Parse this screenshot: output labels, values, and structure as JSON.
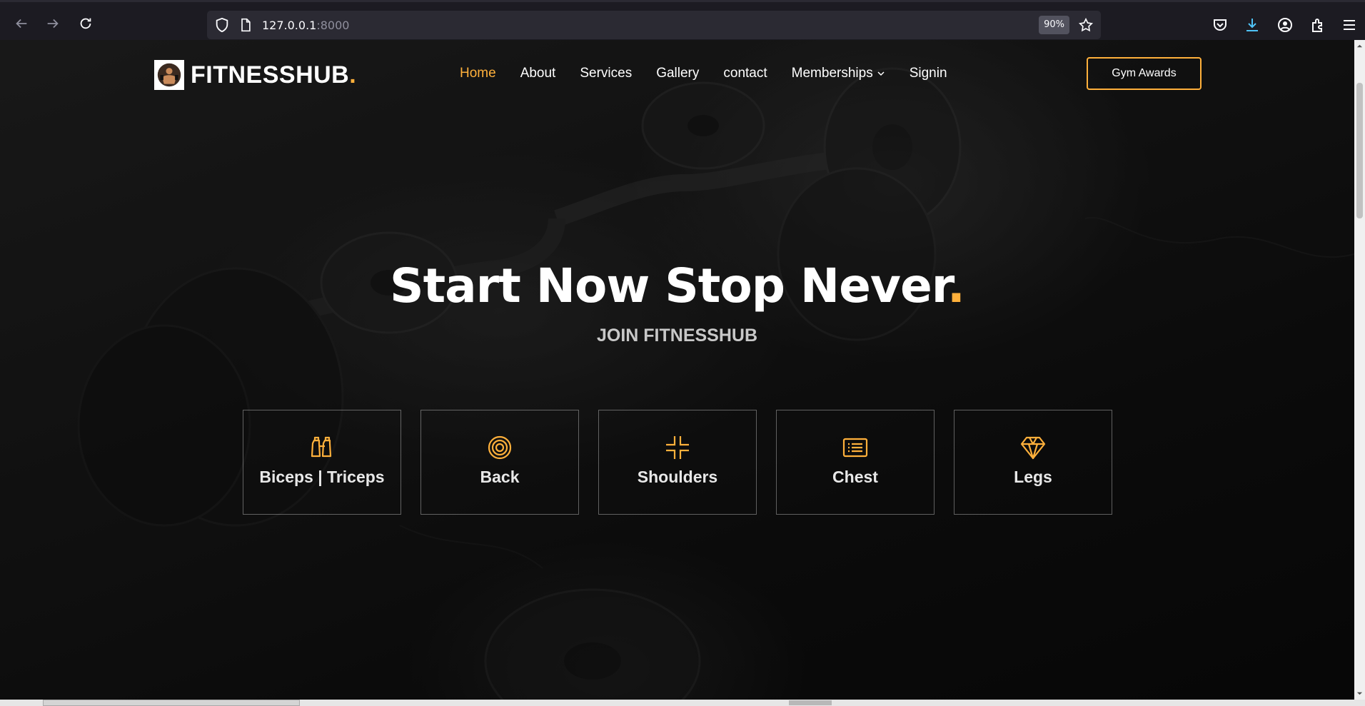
{
  "browser": {
    "url_host": "127.0.0.1",
    "url_port": ":8000",
    "zoom": "90%"
  },
  "site": {
    "logo_text": "FITNESSHUB",
    "logo_dot": ".",
    "nav": [
      {
        "label": "Home",
        "active": true
      },
      {
        "label": "About"
      },
      {
        "label": "Services"
      },
      {
        "label": "Gallery"
      },
      {
        "label": "contact"
      },
      {
        "label": "Memberships",
        "dropdown": true
      },
      {
        "label": "Signin"
      }
    ],
    "cta_button": "Gym Awards"
  },
  "hero": {
    "title": "Start Now Stop Never",
    "title_dot": ".",
    "subtitle": "JOIN FITNESSHUB"
  },
  "cards": [
    {
      "label": "Biceps | Triceps",
      "icon": "binoculars-icon"
    },
    {
      "label": "Back",
      "icon": "target-icon"
    },
    {
      "label": "Shoulders",
      "icon": "compress-arrows-icon"
    },
    {
      "label": "Chest",
      "icon": "list-card-icon"
    },
    {
      "label": "Legs",
      "icon": "diamond-icon"
    }
  ],
  "colors": {
    "accent": "#ffb03b",
    "browser_bg": "#1c1b22",
    "url_bg": "#2b2a33"
  }
}
